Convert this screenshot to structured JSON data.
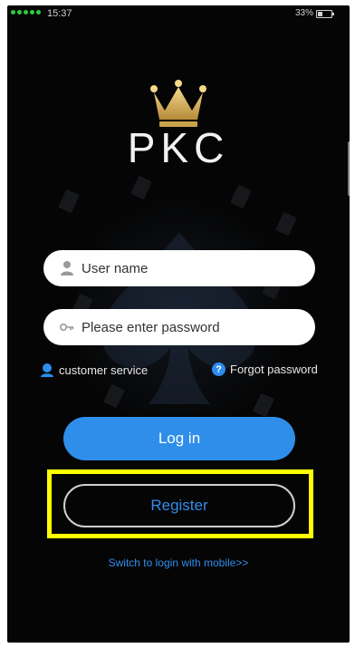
{
  "status_bar": {
    "time": "15:37",
    "battery": "33%"
  },
  "brand": {
    "name": "PKC"
  },
  "login_form": {
    "username_placeholder": "User name",
    "password_placeholder": "Please enter password"
  },
  "links": {
    "customer_service": "customer service",
    "forgot_password": "Forgot password",
    "switch_mobile": "Switch to login with mobile>>"
  },
  "buttons": {
    "login": "Log in",
    "register": "Register"
  },
  "icons": {
    "crown": "crown-icon",
    "user": "user-icon",
    "key": "key-icon",
    "support": "customer-service-icon",
    "help": "question-icon"
  },
  "colors": {
    "accent": "#2f8eea",
    "highlight": "#ffff00",
    "crown_gold": "#d6b25e"
  }
}
